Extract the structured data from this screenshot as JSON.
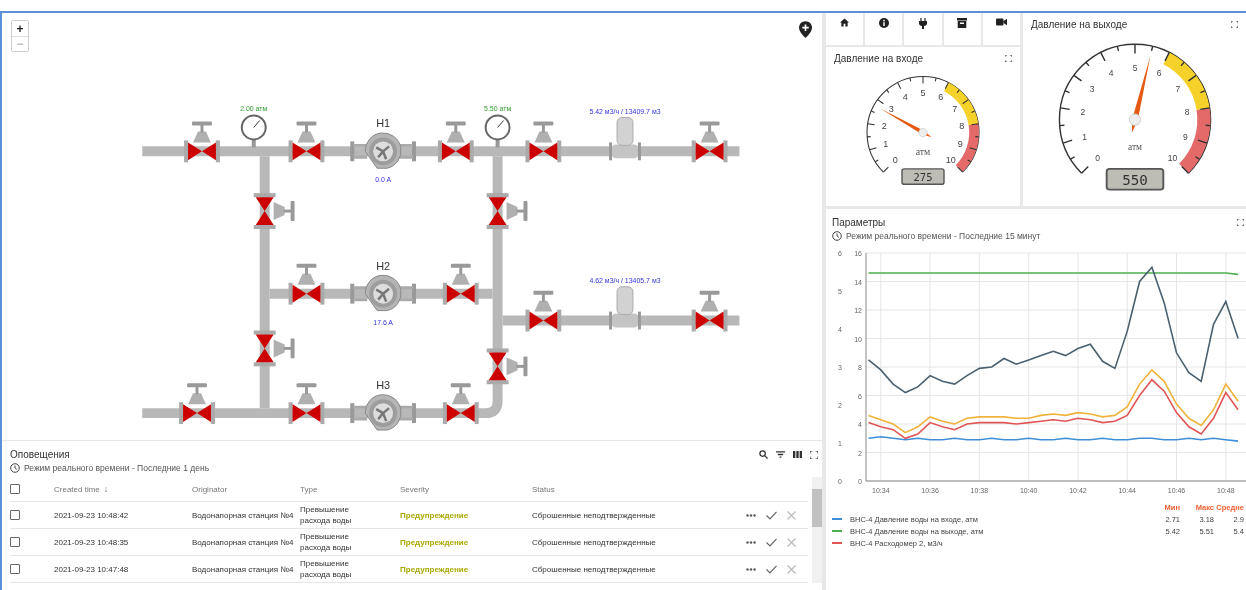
{
  "diagram": {
    "zoom_buttons": [
      "+",
      "−"
    ],
    "pressure_gauges": [
      {
        "reading": "2.00 атм"
      },
      {
        "reading": "5.50 атм"
      }
    ],
    "pumps": [
      {
        "name": "Н1",
        "current": "0.0 A"
      },
      {
        "name": "Н2",
        "current": "17.6 A"
      },
      {
        "name": "Н3"
      }
    ],
    "flow_meters": [
      {
        "reading": "5.42 м3/ч / 13409.7 м3"
      },
      {
        "reading": "4.62 м3/ч / 13405.7 м3"
      }
    ]
  },
  "alarms": {
    "title": "Оповещения",
    "subtitle": "Режим реального времени - Последние 1 день",
    "header_checked": false,
    "columns": [
      {
        "label": "Created time",
        "sort_arrow": "↓"
      },
      {
        "label": "Originator"
      },
      {
        "label": "Type"
      },
      {
        "label": "Severity"
      },
      {
        "label": "Status"
      }
    ],
    "rows": [
      {
        "checked": false,
        "created_time": "2021-09-23 10:48:42",
        "originator": "Водонапорная станция №4",
        "type": "Превышение расхода воды",
        "severity": "Предупреждение",
        "status": "Сброшенные неподтвержденные"
      },
      {
        "checked": false,
        "created_time": "2021-09-23 10:48:35",
        "originator": "Водонапорная станция №4",
        "type": "Превышение расхода воды",
        "severity": "Предупреждение",
        "status": "Сброшенные неподтвержденные"
      },
      {
        "checked": false,
        "created_time": "2021-09-23 10:47:48",
        "originator": "Водонапорная станция №4",
        "type": "Превышение расхода воды",
        "severity": "Предупреждение",
        "status": "Сброшенные неподтвержденные"
      }
    ]
  },
  "gauges": [
    {
      "title": "Давление на входе",
      "level": 0.275,
      "unit": "атм",
      "display": "275",
      "ticks": [
        "0",
        "1",
        "2",
        "3",
        "4",
        "5",
        "6",
        "7",
        "8",
        "9",
        "10"
      ]
    },
    {
      "title": "Давление на выходе",
      "level": 0.55,
      "unit": "атм",
      "display": "550",
      "ticks": [
        "0",
        "1",
        "2",
        "3",
        "4",
        "5",
        "6",
        "7",
        "8",
        "9",
        "10"
      ]
    }
  ],
  "parameters": {
    "title": "Параметры",
    "subtitle": "Режим реального времени - Последние 15 минут",
    "chart_data": {
      "type": "line",
      "grid": true,
      "ylim": [
        0,
        16
      ],
      "categories": [
        null,
        "10:34",
        null,
        null,
        null,
        "10:36",
        null,
        null,
        null,
        "10:38",
        null,
        null,
        null,
        "10:40",
        null,
        null,
        null,
        "10:42",
        null,
        null,
        null,
        "10:44",
        null,
        null,
        null,
        "10:46",
        null,
        null,
        null,
        "10:48",
        null
      ],
      "yticks": [
        0,
        2,
        4,
        6,
        8,
        10,
        12,
        14,
        16
      ],
      "y2lim": [
        0,
        6
      ],
      "y2ticks": [
        0,
        1,
        2,
        3,
        4,
        5,
        6
      ],
      "series": [
        {
          "name": "ВНС-4 Давление воды на входе, атм",
          "color": "#3f8fd8",
          "values": [
            3.0,
            3.1,
            3.0,
            2.9,
            3.0,
            2.9,
            2.9,
            3.0,
            2.9,
            2.9,
            3.0,
            2.9,
            2.9,
            3.0,
            2.9,
            2.9,
            3.0,
            2.9,
            2.9,
            3.0,
            2.9,
            2.9,
            3.0,
            3.0,
            2.9,
            2.9,
            3.0,
            2.9,
            3.0,
            2.9,
            2.8
          ]
        },
        {
          "name": "ВНС-4 Давление воды на выходе, атм",
          "color": "#4caf50",
          "values": [
            14.6,
            14.6,
            14.6,
            14.6,
            14.6,
            14.6,
            14.6,
            14.6,
            14.6,
            14.6,
            14.6,
            14.6,
            14.6,
            14.6,
            14.6,
            14.6,
            14.6,
            14.6,
            14.6,
            14.6,
            14.6,
            14.6,
            14.6,
            14.6,
            14.6,
            14.6,
            14.6,
            14.6,
            14.6,
            14.6,
            14.5
          ]
        },
        {
          "name": "ВНС-4 Расходомер 2, м3/ч",
          "color": "#e05555",
          "values": [
            4.1,
            3.8,
            3.6,
            3.0,
            3.3,
            4.1,
            3.8,
            3.6,
            4.0,
            4.1,
            4.1,
            4.1,
            4.0,
            4.1,
            4.2,
            4.3,
            4.2,
            4.4,
            4.3,
            4.1,
            4.2,
            4.6,
            6.0,
            7.1,
            6.3,
            4.8,
            3.8,
            3.3,
            4.4,
            6.2,
            5.0
          ]
        },
        {
          "color": "#f0b23c",
          "values": [
            4.6,
            4.3,
            4.0,
            3.4,
            3.8,
            4.5,
            4.2,
            4.0,
            4.4,
            4.5,
            4.5,
            4.5,
            4.4,
            4.4,
            4.6,
            4.7,
            4.6,
            4.8,
            4.7,
            4.5,
            4.6,
            5.2,
            6.8,
            7.8,
            7.0,
            5.4,
            4.4,
            3.9,
            5.0,
            6.8,
            5.6
          ]
        },
        {
          "color": "#4a6070",
          "values": [
            8.5,
            7.8,
            6.8,
            6.2,
            6.6,
            7.4,
            7.0,
            6.8,
            7.4,
            7.9,
            8.0,
            8.6,
            8.2,
            8.5,
            8.8,
            9.1,
            8.8,
            9.3,
            9.6,
            8.4,
            7.9,
            10.5,
            14.0,
            15.0,
            12.5,
            9.0,
            7.6,
            7.0,
            11.0,
            12.6,
            10.0
          ]
        }
      ]
    },
    "legend": {
      "columns": [
        "Мин",
        "Макс",
        "Средне"
      ],
      "rows": [
        {
          "values": [
            "2.71",
            "3.18",
            "2.9"
          ]
        },
        {
          "values": [
            "5.42",
            "5.51",
            "5.4"
          ]
        }
      ]
    }
  }
}
